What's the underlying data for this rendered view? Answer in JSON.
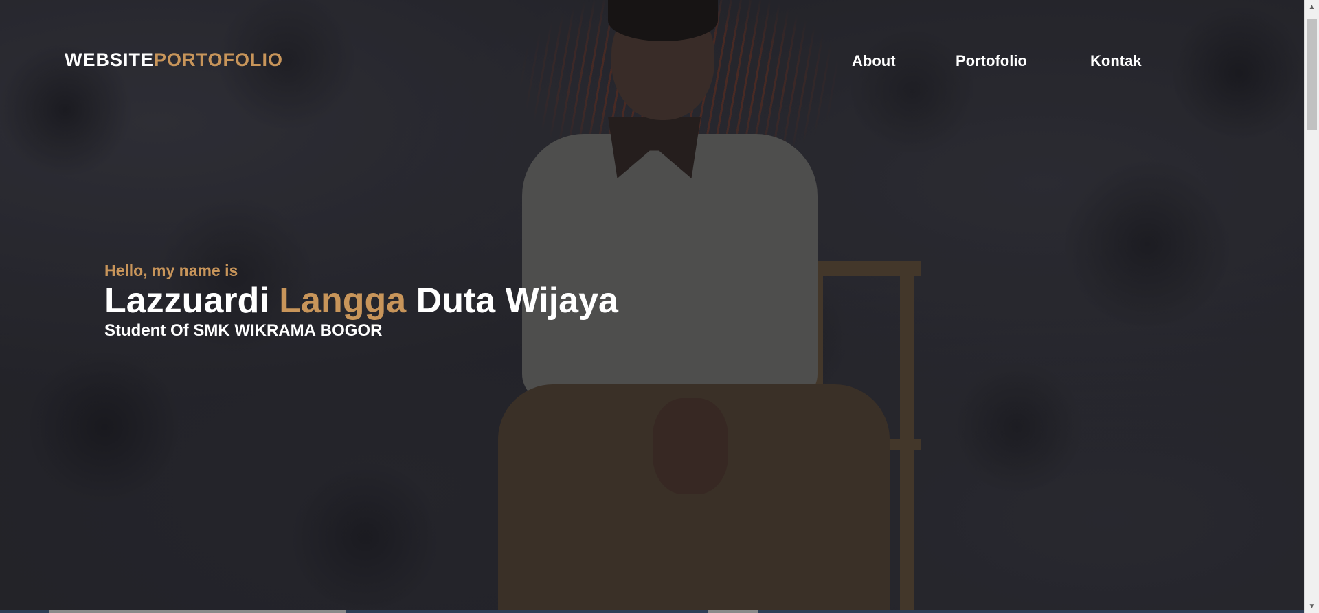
{
  "navbar": {
    "brand_primary": "WEBSITE",
    "brand_accent": "PORTOFOLIO",
    "links": [
      {
        "label": "About"
      },
      {
        "label": "Portofolio"
      },
      {
        "label": "Kontak"
      }
    ]
  },
  "hero": {
    "greeting": "Hello, my name is",
    "name_first": "Lazzuardi",
    "name_accent": "Langga",
    "name_last": "Duta Wijaya",
    "subtitle": "Student Of SMK WIKRAMA BOGOR"
  },
  "colors": {
    "accent": "#c8955a",
    "text": "#ffffff",
    "background": "#2a2a30"
  },
  "icons": {
    "scroll_up": "triangle-up",
    "scroll_down": "triangle-down"
  }
}
